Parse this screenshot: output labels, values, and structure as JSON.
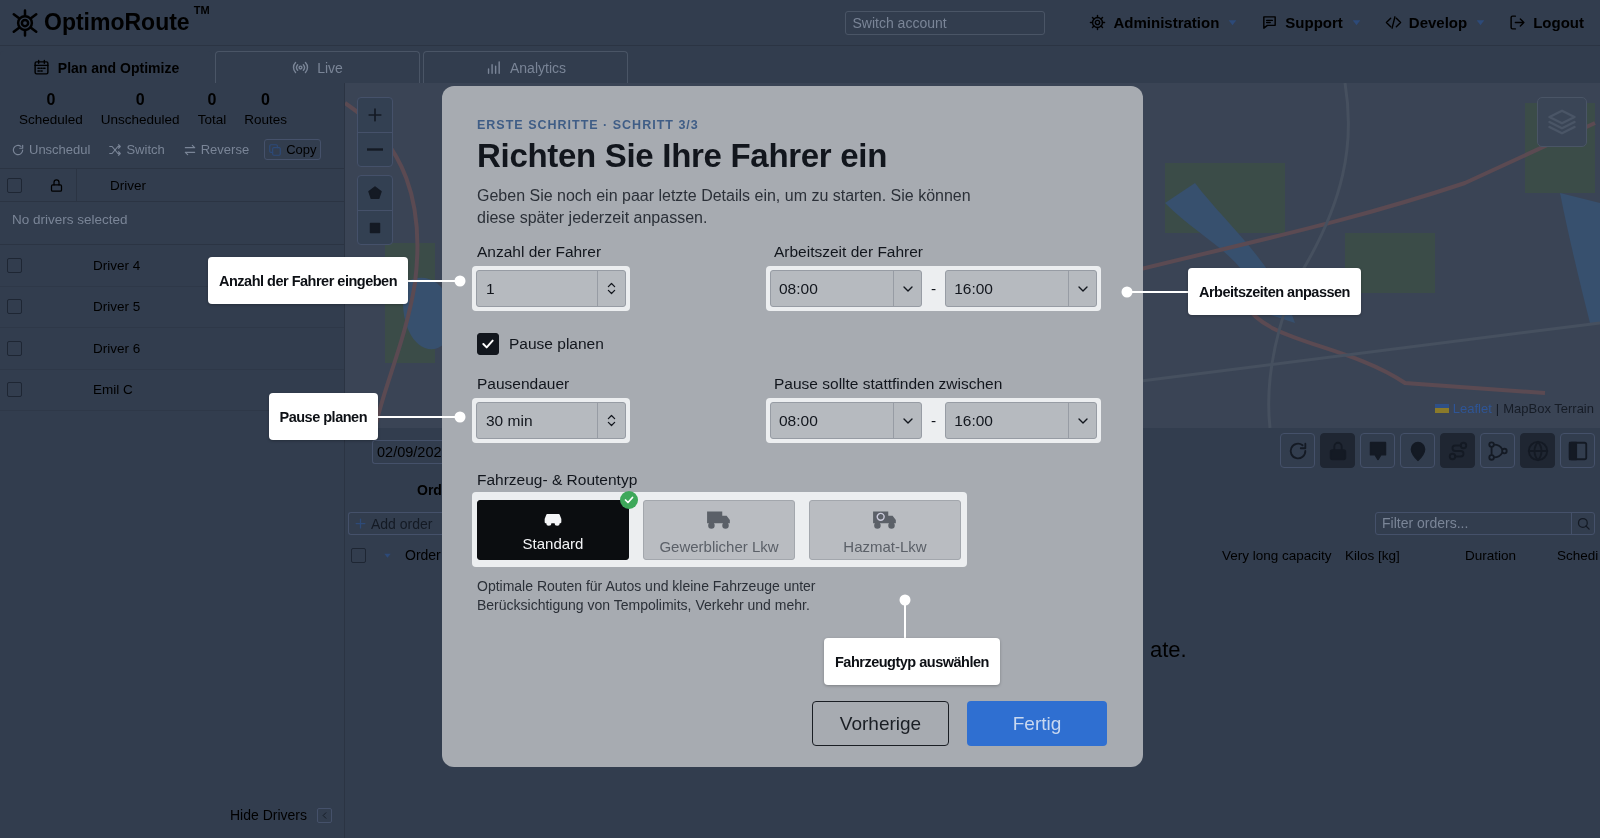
{
  "header": {
    "logo": {
      "name": "OptimoRoute",
      "mark": "TM"
    },
    "switch_account": {
      "placeholder": "Switch account"
    },
    "menus": [
      {
        "kind": "admin",
        "label": "Administration",
        "dropdown": true
      },
      {
        "kind": "support",
        "label": "Support",
        "dropdown": true
      },
      {
        "kind": "develop",
        "label": "Develop",
        "dropdown": true
      },
      {
        "kind": "logout",
        "label": "Logout",
        "dropdown": false
      }
    ]
  },
  "tabs": [
    {
      "kind": "plan",
      "label": "Plan and Optimize",
      "selected": true
    },
    {
      "kind": "live",
      "label": "Live",
      "selected": false
    },
    {
      "kind": "analytics",
      "label": "Analytics",
      "selected": false
    }
  ],
  "summary": [
    {
      "value": "0",
      "label": "Scheduled"
    },
    {
      "value": "0",
      "label": "Unscheduled"
    },
    {
      "value": "0",
      "label": "Total"
    },
    {
      "value": "0",
      "label": "Routes"
    }
  ],
  "driver_actions": [
    {
      "kind": "unschedule",
      "label": "Unschedul",
      "disabled": true
    },
    {
      "kind": "switch",
      "label": "Switch",
      "disabled": true
    },
    {
      "kind": "reverse",
      "label": "Reverse",
      "disabled": true
    },
    {
      "kind": "copy",
      "label": "Copy",
      "disabled": false
    }
  ],
  "drivers": {
    "all_checked": false,
    "column": "Driver",
    "empty_message": "No drivers selected",
    "rows": [
      {
        "name": "Driver 4",
        "checked": false
      },
      {
        "name": "Driver 5",
        "checked": false
      },
      {
        "name": "Driver 6",
        "checked": false
      },
      {
        "name": "Emil C",
        "checked": false
      }
    ]
  },
  "hide_drivers": "Hide Drivers",
  "map": {
    "attribution": {
      "link": "Leaflet",
      "separator": "|",
      "source": "MapBox Terrain"
    }
  },
  "map_tools": [
    {
      "kind": "refresh",
      "active": false
    },
    {
      "kind": "lock",
      "active": true
    },
    {
      "kind": "pin-star",
      "active": false
    },
    {
      "kind": "pin",
      "active": false
    },
    {
      "kind": "route",
      "active": true
    },
    {
      "kind": "branches",
      "active": false
    },
    {
      "kind": "globe",
      "active": true
    },
    {
      "kind": "sidebar",
      "active": false
    }
  ],
  "orders": {
    "date": "02/09/202",
    "title": "Ord",
    "add_button": "Add order",
    "filter": {
      "placeholder": "Filter orders..."
    },
    "all_checked": false,
    "columns_left": [
      "Order"
    ],
    "columns_right": [
      "Very long capacity",
      "Kilos [kg]",
      "Duration",
      "Schedi"
    ],
    "empty_message": "ate."
  },
  "dialog": {
    "eyebrow": "ERSTE SCHRITTE · SCHRITT 3/3",
    "title": "Richten Sie Ihre Fahrer ein",
    "description": "Geben Sie noch ein paar letzte Details ein, um zu starten. Sie können diese später jederzeit anpassen.",
    "driver_count": {
      "label": "Anzahl der Fahrer",
      "value": "1"
    },
    "work_hours": {
      "label": "Arbeitszeit der Fahrer",
      "from": "08:00",
      "separator": "-",
      "to": "16:00"
    },
    "plan_break": {
      "label": "Pause planen",
      "checked": true
    },
    "break_duration": {
      "label": "Pausendauer",
      "value": "30 min"
    },
    "break_window": {
      "label": "Pause sollte stattfinden zwischen",
      "from": "08:00",
      "separator": "-",
      "to": "16:00"
    },
    "vehicle": {
      "label": "Fahrzeug- & Routentyp",
      "options": [
        {
          "kind": "car",
          "label": "Standard",
          "selected": true
        },
        {
          "kind": "truck",
          "label": "Gewerblicher Lkw",
          "selected": false
        },
        {
          "kind": "hazmat",
          "label": "Hazmat-Lkw",
          "selected": false
        }
      ],
      "description": "Optimale Routen für Autos und kleine Fahrzeuge unter Berücksichtigung von Tempolimits, Verkehr und mehr."
    },
    "buttons": [
      {
        "kind": "secondary",
        "label": "Vorherige"
      },
      {
        "kind": "primary",
        "label": "Fertig"
      }
    ]
  },
  "callouts": [
    {
      "text": "Anzahl der Fahrer eingeben"
    },
    {
      "text": "Arbeitszeiten anpassen"
    },
    {
      "text": "Pause planen"
    },
    {
      "text": "Fahrzeugtyp auswählen"
    }
  ]
}
